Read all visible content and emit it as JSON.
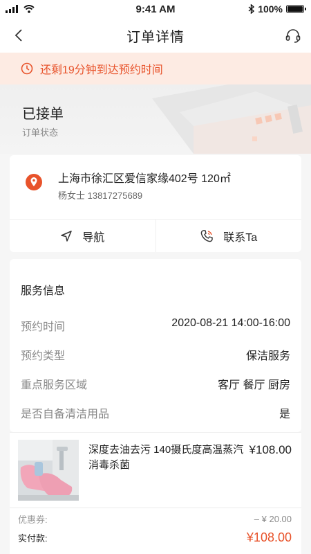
{
  "status_bar": {
    "time": "9:41 AM",
    "battery": "100%"
  },
  "nav": {
    "title": "订单详情"
  },
  "notice": {
    "text": "还剩19分钟到达预约时间"
  },
  "order_status": {
    "title": "已接单",
    "subtitle": "订单状态"
  },
  "address": {
    "line": "上海市徐汇区爱信家缘402号 120㎡",
    "contact": "杨女士   13817275689",
    "navigate_label": "导航",
    "contact_label": "联系Ta"
  },
  "service": {
    "title": "服务信息",
    "rows": [
      {
        "label": "预约时间",
        "value": "2020-08-21 14:00-16:00"
      },
      {
        "label": "预约类型",
        "value": "保洁服务"
      },
      {
        "label": "重点服务区域",
        "value": "客厅 餐厅 厨房"
      },
      {
        "label": "是否自备清洁用品",
        "value": "是"
      }
    ]
  },
  "product": {
    "name": "深度去油去污 140摄氏度高温蒸汽消毒杀菌",
    "price": "¥108.00"
  },
  "payment": {
    "coupon_label": "优惠券:",
    "coupon_value": "– ¥ 20.00",
    "paid_label": "实付款:",
    "paid_value": "¥108.00"
  },
  "colors": {
    "accent": "#e8532b",
    "notice_bg": "#fdebe3"
  }
}
